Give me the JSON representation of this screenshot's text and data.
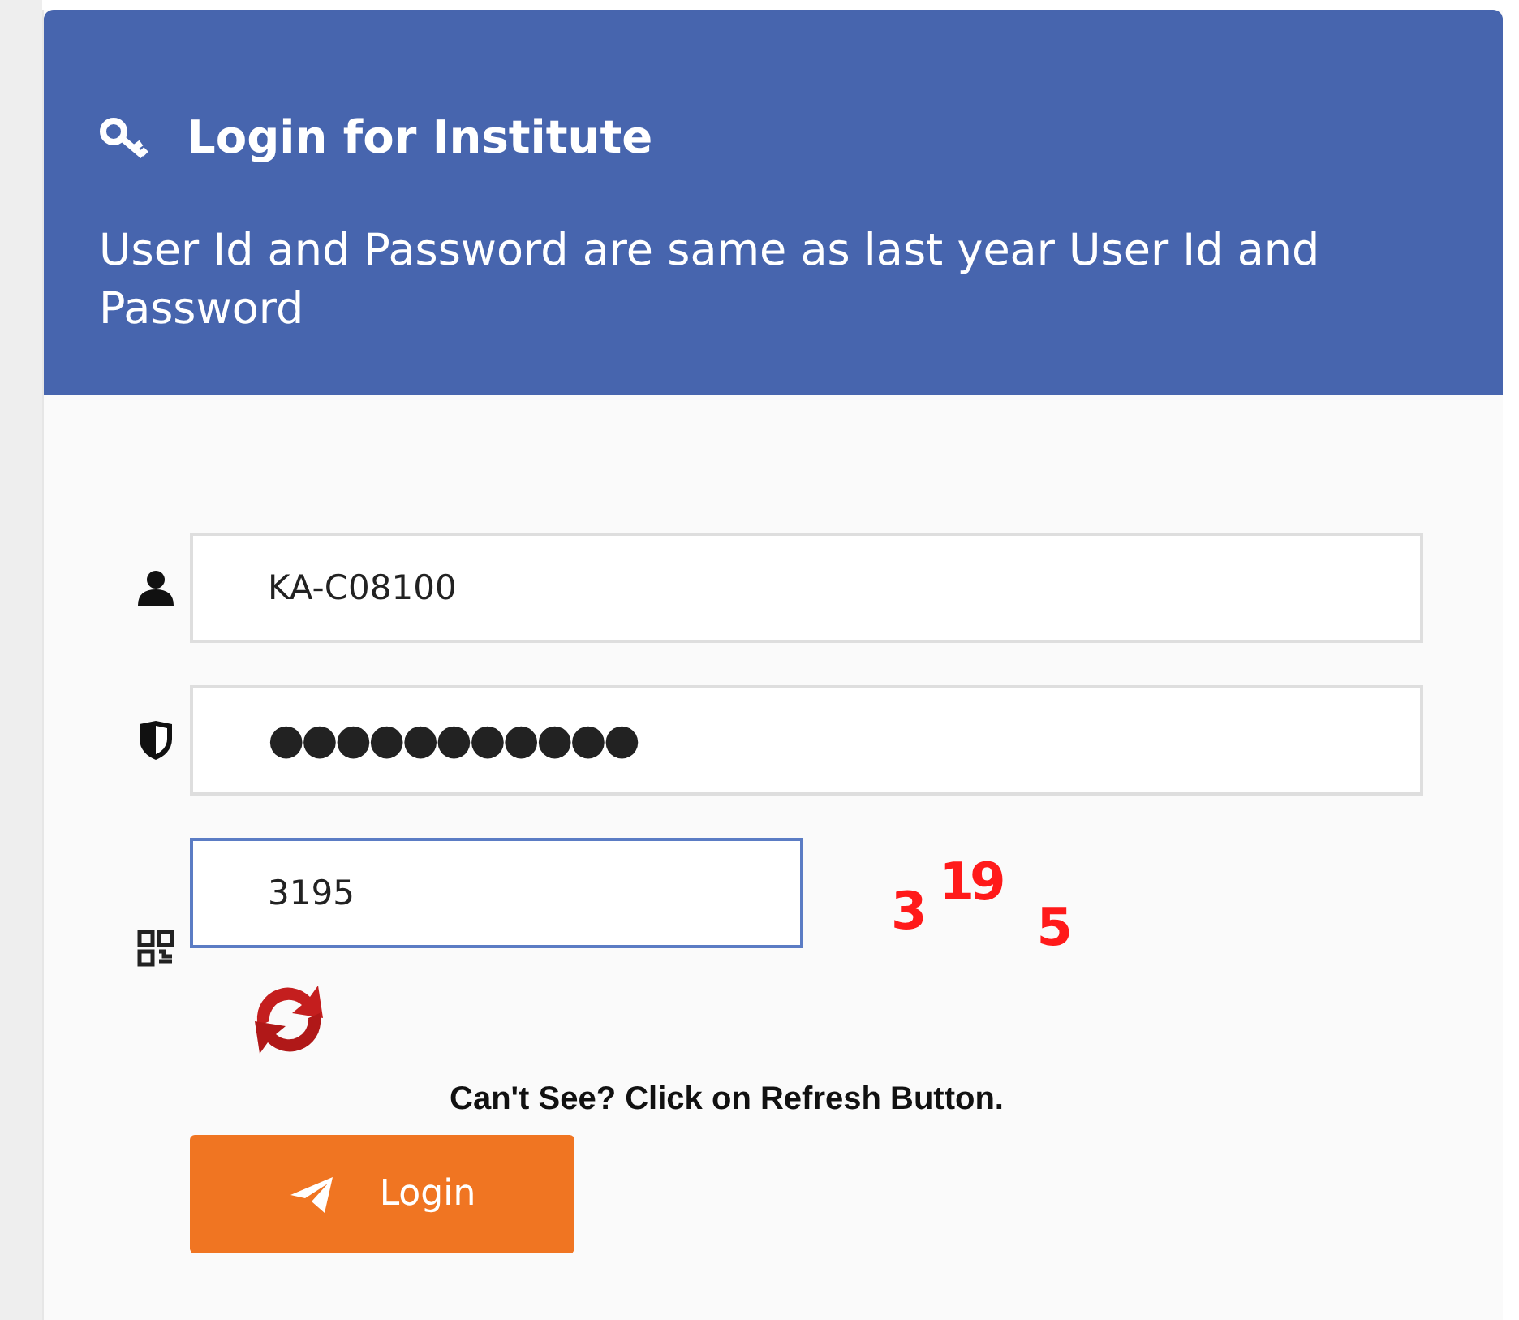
{
  "header": {
    "title": "Login for Institute",
    "subtitle": "User Id and Password are same as last year User Id and Password"
  },
  "fields": [
    {
      "kind": "user",
      "value": "KA-C08100",
      "focused": false
    },
    {
      "kind": "password",
      "value": "●●●●●●●●●●●",
      "focused": false
    },
    {
      "kind": "captcha",
      "value": "3195",
      "focused": true
    }
  ],
  "captcha": {
    "parts": [
      "3",
      "19",
      "5"
    ]
  },
  "refresh_hint": "Can't See? Click on Refresh Button.",
  "login_button": "Login"
}
